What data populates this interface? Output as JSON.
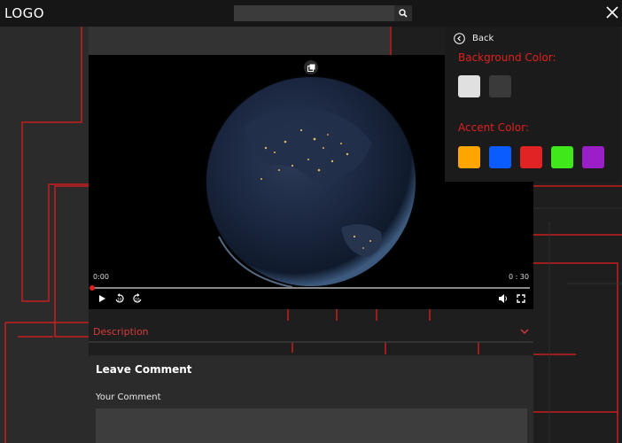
{
  "header": {
    "logo": "LOGO",
    "search_placeholder": "",
    "search_icon": "magnifier-icon",
    "close_icon": "close-x-icon"
  },
  "video": {
    "current_time": "0:00",
    "total_time": "0 : 30",
    "progress": 0,
    "icons": [
      "picture-in-picture-icon",
      "play-icon",
      "rewind-10-icon",
      "forward-10-icon",
      "volume-icon",
      "fullscreen-icon"
    ]
  },
  "description": {
    "label": "Description",
    "chevron_icon": "chevron-down-icon"
  },
  "comment": {
    "title": "Leave Comment",
    "field_label": "Your Comment",
    "field_value": ""
  },
  "settings": {
    "back_label": "Back",
    "back_icon": "chevron-left-circle-icon",
    "background_title": "Background Color:",
    "background_colors": [
      "#e0e0e0",
      "#3a3a3a"
    ],
    "accent_title": "Accent Color:",
    "accent_colors": [
      "#ffa500",
      "#0a5cff",
      "#e02424",
      "#3ee81a",
      "#9a1fc7"
    ]
  },
  "colors": {
    "accent": "#e02020",
    "page_bg": "#1e1e1e",
    "header_bg": "#161616"
  }
}
